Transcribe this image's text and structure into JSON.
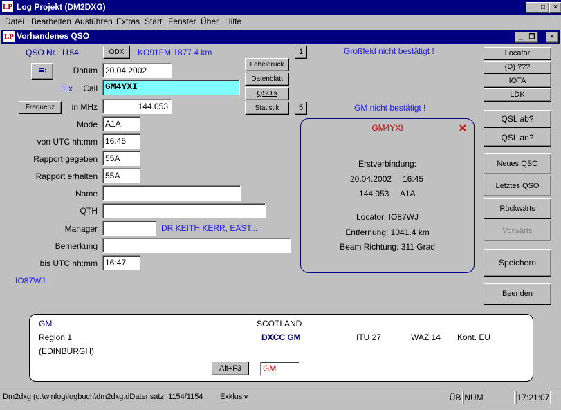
{
  "app": {
    "icon": "LP",
    "title": "Log Projekt (DM2DXG)"
  },
  "window_controls": {
    "min": "_",
    "max": "□",
    "close": "×",
    "restore": "❐"
  },
  "menu": [
    "Datei",
    "Bearbeiten",
    "Ausführen",
    "Extras",
    "Start",
    "Fenster",
    "Über",
    "Hilfe"
  ],
  "child": {
    "title": "Vorhandenes QSO"
  },
  "top": {
    "qso_nr_label": "QSO Nr.",
    "qso_nr": "1154",
    "odx_button": "ODX",
    "locator_info": "KO91FM  1877.4 km",
    "one_button": "1",
    "warning1": "Großfeld nicht bestätigt !",
    "five_button": "5",
    "warning2": "GM nicht bestätigt !"
  },
  "form": {
    "list_button": "≣⁞",
    "datum_label": "Datum",
    "datum": "20.04.2002",
    "count": "1 x",
    "call_label": "Call",
    "call": "GM4YXI",
    "frequenz_button": "Frequenz",
    "freq_label": "in MHz",
    "freq": "144.053",
    "mode_label": "Mode",
    "mode": "A1A",
    "von_label": "von UTC  hh:mm",
    "von": "16:45",
    "rg_label": "Rapport gegeben",
    "rg": "55A",
    "re_label": "Rapport erhalten",
    "re": "55A",
    "name_label": "Name",
    "name": "",
    "qth_label": "QTH",
    "qth": "",
    "manager_label": "Manager",
    "manager": "",
    "manager_info": "DR KEITH KERR, EAST...",
    "bemerkung_label": "Bemerkung",
    "bemerkung": "",
    "bis_label": "bis UTC  hh:mm",
    "bis": "16:47",
    "locator_display": "IO87WJ"
  },
  "mid_buttons": [
    "Labeldruck",
    "Datenblatt",
    "QSO's",
    "Statistik"
  ],
  "popup": {
    "call": "GM4YXI",
    "close": "✕",
    "erst_label": "Erstverbindung:",
    "erst_date": "20.04.2002",
    "erst_time": "16:45",
    "erst_freq": "144.053",
    "erst_mode": "A1A",
    "locator": "Locator: IO87WJ",
    "entfernung": "Entfernung: 1041.4 km",
    "beam": "Beam Richtung: 311 Grad"
  },
  "right_buttons": {
    "locator": "Locator",
    "d": "(D) ???",
    "iota": "IOTA",
    "ldk": "LDK",
    "qsl_ab": "QSL ab?",
    "qsl_an": "QSL an?",
    "neues": "Neues QSO",
    "letztes": "Letztes QSO",
    "rueck": "Rückwärts",
    "vor": "Vorwärts",
    "speichern": "Speichern",
    "beenden": "Beenden"
  },
  "dxcc": {
    "prefix": "GM",
    "country": "SCOTLAND",
    "region": "Region 1",
    "dxcc": "DXCC GM",
    "itu": "ITU 27",
    "waz": "WAZ 14",
    "kont": "Kont. EU",
    "sub": "(EDINBURGH)",
    "altf3": "Alt+F3",
    "prefix_field": "GM"
  },
  "status": {
    "file": "Dm2dxg (c:\\winlog\\logbuch\\dm2dxg.dDatensatz: 1154/1154",
    "mode": "Exklusiv",
    "ub": "ÜB",
    "num": "NUM",
    "empty": "",
    "time": "17:21:07"
  },
  "colors": {
    "titlebar": "#000080",
    "call_bg": "#80ffff",
    "accent_blue": "#1a1aff",
    "popup_red": "#cc0000"
  }
}
